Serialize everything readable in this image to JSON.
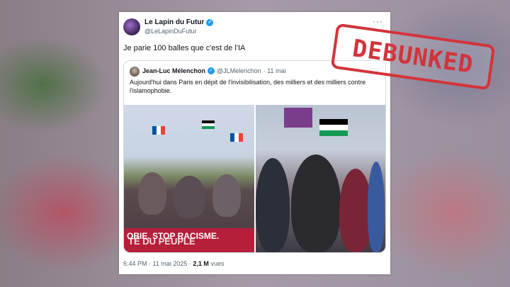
{
  "tweet": {
    "author_name": "Le Lapin du Futur",
    "author_handle": "@LeLapinDuFutur",
    "text": "Je parie 100 balles que c'est de l'IA",
    "more_label": "···",
    "time": "6:44 PM · 11 mai 2025 ·",
    "views_count": "2,1 M",
    "views_label": "vues"
  },
  "quoted": {
    "author_name": "Jean-Luc Mélenchon",
    "author_handle": "@JLMelenchon",
    "date": "· 11 mai",
    "text": "Aujourd'hui dans Paris en dépit de l'invisibilisation, des milliers et des milliers contre l'islamophobie.",
    "banner_text": "OBIE. STOP RACISME.",
    "banner_text2": "TÉ DU PEUPLE"
  },
  "stamp": {
    "label": "DEBUNKED",
    "color": "#d3333b"
  },
  "colors": {
    "verified": "#1d9bf0",
    "banner": "#b51f3a"
  }
}
